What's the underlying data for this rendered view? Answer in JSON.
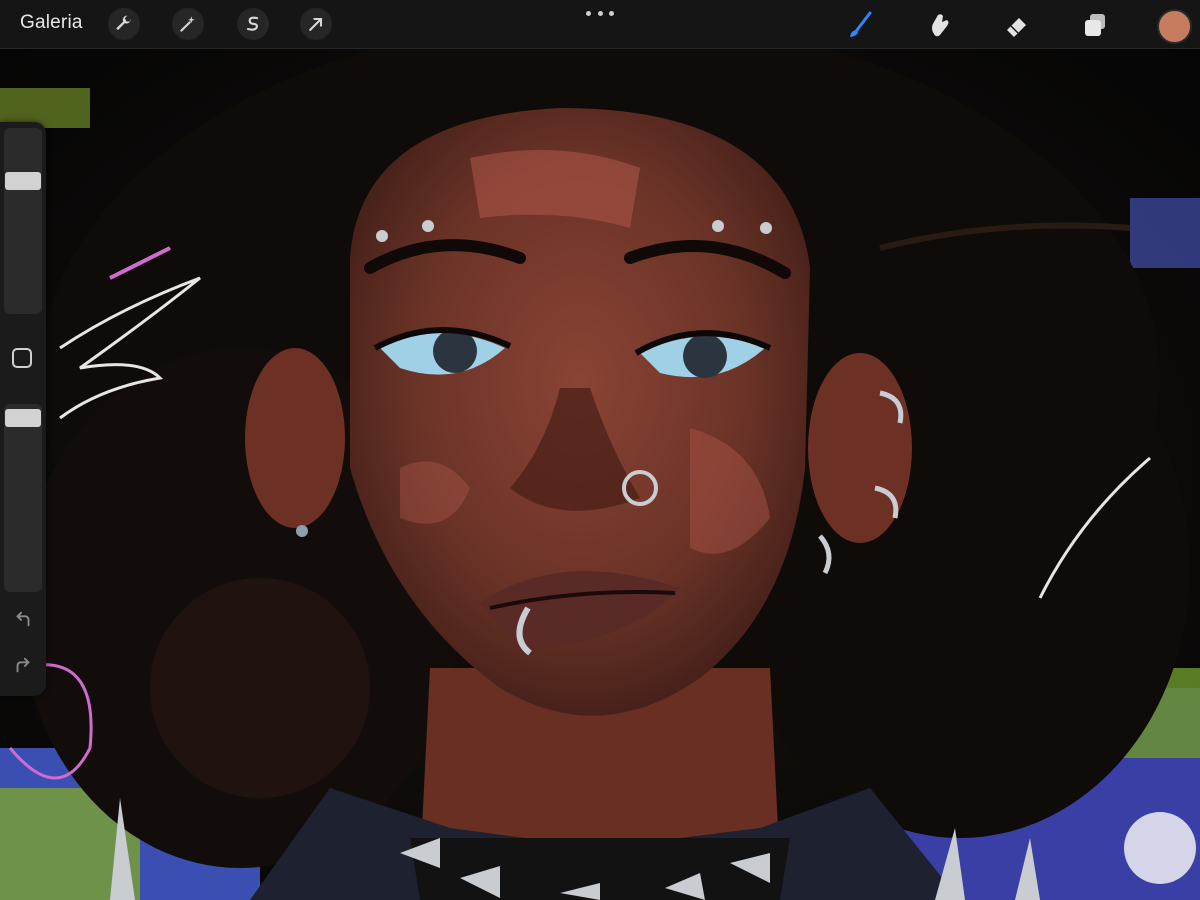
{
  "toolbar": {
    "gallery_label": "Galeria",
    "left_tools": [
      {
        "icon": "wrench-icon",
        "name": "actions"
      },
      {
        "icon": "magic-wand-icon",
        "name": "adjustments"
      },
      {
        "icon": "selection-s-icon",
        "name": "selection"
      },
      {
        "icon": "move-arrow-icon",
        "name": "transform"
      }
    ],
    "more_icon": "more-dots-icon",
    "right_tools": [
      {
        "icon": "brush-icon",
        "name": "paint",
        "active": true
      },
      {
        "icon": "smudge-icon",
        "name": "smudge",
        "active": false
      },
      {
        "icon": "eraser-icon",
        "name": "erase",
        "active": false
      },
      {
        "icon": "layers-icon",
        "name": "layers",
        "active": false
      }
    ],
    "current_color": "#c77c60",
    "active_tool_color": "#2f86f6"
  },
  "sidebar": {
    "brush_size_level": 0.74,
    "opacity_level": 0.97,
    "modify_icon": "square-modify-icon",
    "undo_icon": "undo-icon",
    "redo_icon": "redo-icon"
  },
  "canvas": {
    "subject": "digital-painting-portrait",
    "colors": {
      "skin": "#7a3b2e",
      "skin_light": "#b0574a",
      "hair": "#0e0b08",
      "eyes": "#9fd0e6",
      "lips": "#5a2a26",
      "metal": "#c9ccd1",
      "pink_scribble": "#d06bd0",
      "blue_pattern": "#3b4fb3",
      "green_pattern": "#7da32f"
    }
  }
}
